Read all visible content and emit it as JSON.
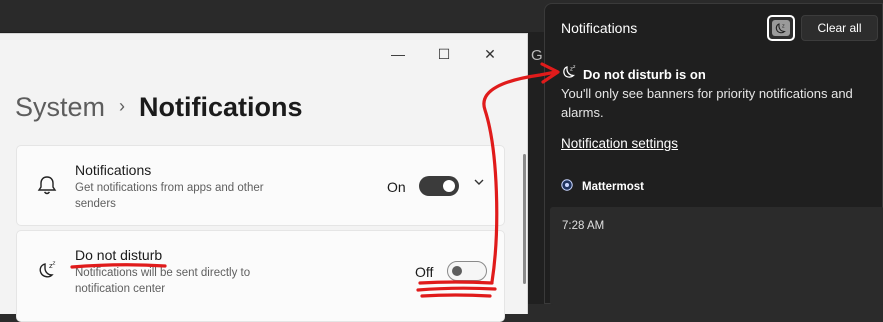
{
  "background": {
    "letter": "G"
  },
  "settings": {
    "breadcrumb": {
      "parent": "System",
      "separator": "›",
      "current": "Notifications"
    },
    "window_controls": [
      "—",
      "☐",
      "✕"
    ],
    "notifications_card": {
      "title": "Notifications",
      "description": "Get notifications from apps and other senders",
      "toggle_label": "On",
      "toggle_state": true,
      "icon": "bell-icon"
    },
    "dnd_card": {
      "title": "Do not disturb",
      "description": "Notifications will be sent directly to notification center",
      "toggle_label": "Off",
      "toggle_state": false,
      "icon": "dnd-moon-icon"
    }
  },
  "panel": {
    "title": "Notifications",
    "clear_all": "Clear all",
    "dnd_heading": "Do not disturb is on",
    "dnd_description": "You'll only see banners for priority notifications and alarms.",
    "settings_link": "Notification settings",
    "app_name": "Mattermost",
    "time": "7:28 AM"
  },
  "colors": {
    "panel_bg": "#1f1f1f",
    "settings_bg": "#f3f3f3",
    "annotation_red": "#e01b1b"
  }
}
